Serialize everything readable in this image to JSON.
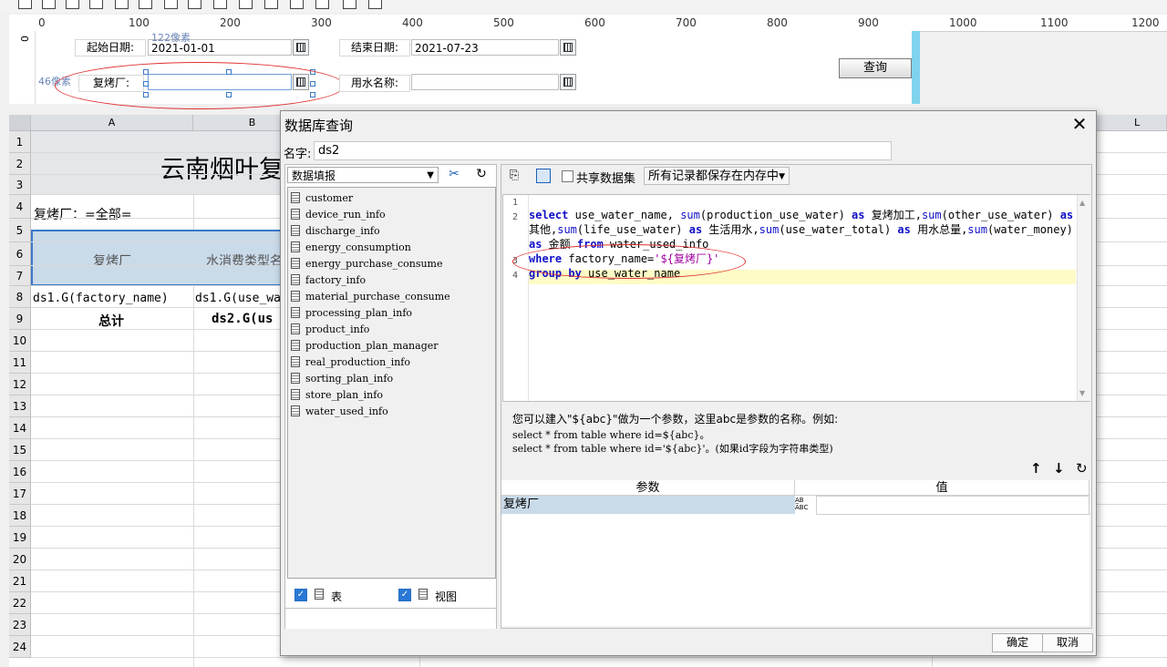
{
  "ruler": {
    "ticks": [
      "0",
      "100",
      "200",
      "300",
      "400",
      "500",
      "600",
      "700",
      "800",
      "900",
      "1000",
      "1100",
      "1200"
    ]
  },
  "params": {
    "start_label": "起始日期:",
    "start_value": "2021-01-01",
    "end_label": "结束日期:",
    "end_value": "2021-07-23",
    "factory_label": "复烤厂:",
    "water_label": "用水名称:",
    "width_hint": "122像素",
    "height_hint": "46像素",
    "query_label": "查询"
  },
  "sheet": {
    "col_headers": [
      "A",
      "B",
      "L"
    ],
    "row_numbers": [
      "1",
      "2",
      "3",
      "4",
      "5",
      "6",
      "7",
      "8",
      "9",
      "10",
      "11",
      "12",
      "13",
      "14",
      "15",
      "16",
      "17",
      "18",
      "19",
      "20",
      "21",
      "22",
      "23",
      "24"
    ],
    "title": "云南烟叶复",
    "filter_text": "复烤厂：=全部=",
    "header_a": "复烤厂",
    "header_b": "水消费类型名",
    "row7_a": "ds1.G(factory_name)",
    "row7_b": "ds1.G(use_wa",
    "row8_a": "总计",
    "row8_b": "ds2.G(us"
  },
  "dialog": {
    "title": "数据库查询",
    "close": "✕",
    "name_label": "名字:",
    "name_value": "ds2",
    "datasource": "数据填报",
    "tables": [
      "customer",
      "device_run_info",
      "discharge_info",
      "energy_consumption",
      "energy_purchase_consume",
      "factory_info",
      "material_purchase_consume",
      "processing_plan_info",
      "product_info",
      "production_plan_manager",
      "real_production_info",
      "sorting_plan_info",
      "store_plan_info",
      "water_used_info"
    ],
    "show_tables_label": "表",
    "show_views_label": "视图",
    "share_label": "共享数据集",
    "memory_option": "所有记录都保存在内存中",
    "line_numbers": [
      "1",
      "2",
      "3",
      "4"
    ],
    "hint_line1": "您可以建入\"${abc}\"做为一个参数，这里abc是参数的名称。例如:",
    "hint_line2": "select * from table where id=${abc}。",
    "hint_line3": "select * from table where id='${abc}'。(如果id字段为字符串类型)",
    "param_col": "参数",
    "value_col": "值",
    "param_name": "复烤厂",
    "ok_label": "确定",
    "cancel_label": "取消"
  }
}
